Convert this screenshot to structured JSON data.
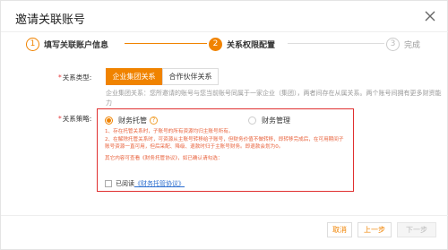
{
  "dialog": {
    "title": "邀请关联账号"
  },
  "steps": [
    {
      "num": "1",
      "label": "填写关联账户信息",
      "state": "done"
    },
    {
      "num": "2",
      "label": "关系权限配置",
      "state": "active"
    },
    {
      "num": "3",
      "label": "完成",
      "state": "todo"
    }
  ],
  "colors": {
    "accent": "#f08300",
    "highlight_box": "#e03030",
    "note_text": "#e8603a",
    "link": "#2d6fcf"
  },
  "relation_type": {
    "required_mark": "*",
    "label": "关系类型:",
    "options": [
      "企业集团关系",
      "合作伙伴关系"
    ],
    "selected": "企业集团关系",
    "description": "企业集团关系：您所邀请的账号与您当前账号同属于一家企业（集团），两者间存在从属关系。两个账号间拥有更多财资能力"
  },
  "relation_strategy": {
    "required_mark": "*",
    "label": "关系策略:",
    "options": [
      {
        "label": "财务托管",
        "selected": true,
        "help_icon": "question-circle-icon"
      },
      {
        "label": "财务管理",
        "selected": false
      }
    ],
    "notes": [
      "1、存在托管关系时，子账号的所有资源均归主账号所有。",
      "2、在解除托管关系时，可资源从主账号转移给子账号，但财务价值不做转移，即转移完成后，在可用期间子账号资源一直可用，但后采配、降级、退款时归于主账号财务。即退款会划为0。",
      "其它内容可查看《财务托管协议》，如已确认请勾选："
    ],
    "agreement_prefix": "已阅读",
    "agreement_link": "《财务托管协议》",
    "agreement_checked": false
  },
  "footer": {
    "cancel_label": "取消",
    "prev_label": "上一步",
    "next_label": "下一步"
  }
}
